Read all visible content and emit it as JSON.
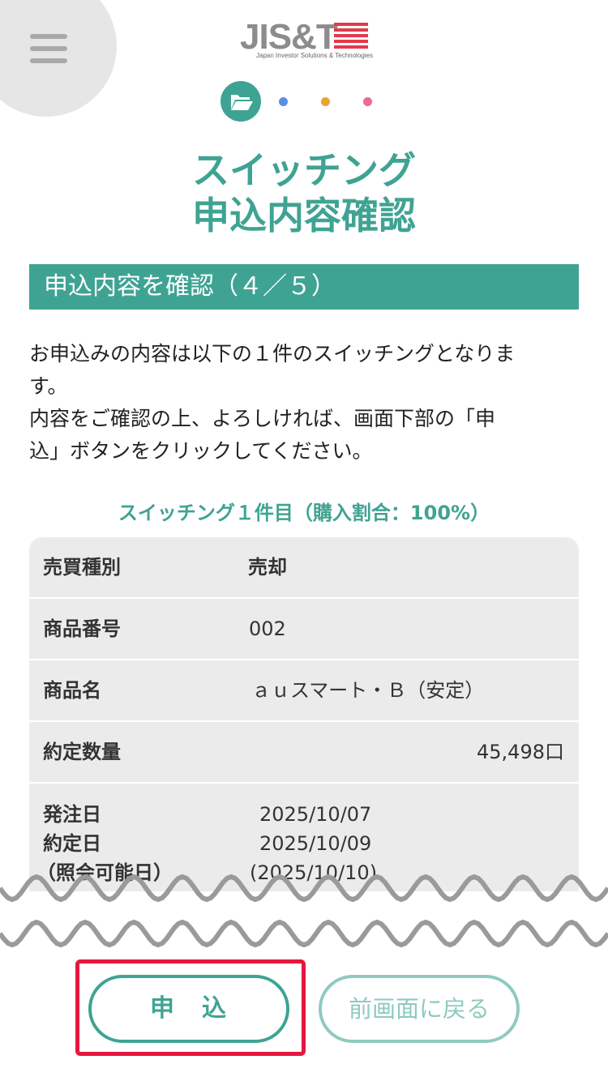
{
  "header": {
    "logo_text": "JIS&T",
    "logo_subtitle": "Japan Investor Solutions & Technologies",
    "menu_icon": "hamburger-menu-icon",
    "active_step_icon": "folder-open-icon",
    "step_colors": [
      "#3fa393",
      "#5b8ee6",
      "#e9a431",
      "#f0698f"
    ]
  },
  "title": {
    "line1": "スイッチング",
    "line2": "申込内容確認"
  },
  "section": {
    "heading": "申込内容を確認（４／５）"
  },
  "intro": {
    "line1": "お申込みの内容は以下の１件のスイッチングとなりま",
    "line2": "す。",
    "line3": "内容をご確認の上、よろしければ、画面下部の「申",
    "line4": "込」ボタンをクリックしてください。"
  },
  "case_title": "スイッチング１件目（購入割合：100%）",
  "table": {
    "rows": [
      {
        "label": "売買種別",
        "value": "売却"
      },
      {
        "label": "商品番号",
        "value": "002"
      },
      {
        "label": "商品名",
        "value": "ａｕスマート・Ｂ（安定）"
      },
      {
        "label": "約定数量",
        "value": "45,498口"
      }
    ],
    "dates": {
      "order_label": "発注日",
      "order_value": "2025/10/07",
      "contract_label": "約定日",
      "contract_value": "2025/10/09",
      "inquiry_label": "（照会可能日）",
      "inquiry_value": "(2025/10/10)"
    }
  },
  "buttons": {
    "apply": "申　込",
    "back": "前画面に戻る"
  },
  "colors": {
    "accent": "#3fa393",
    "highlight": "#e5173f"
  }
}
